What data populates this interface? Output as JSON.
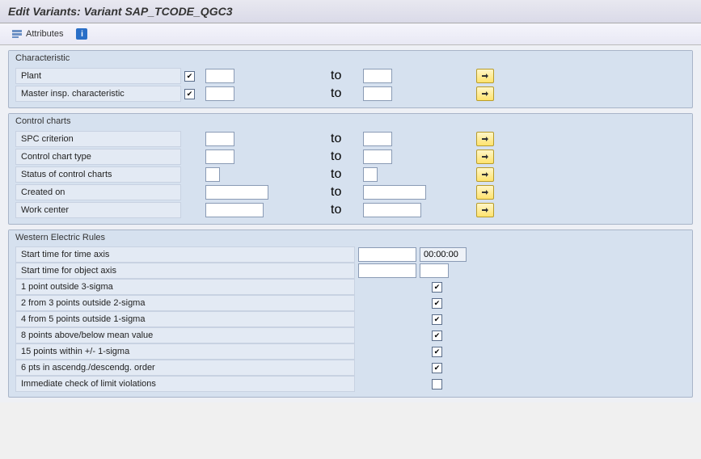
{
  "header": {
    "title": "Edit Variants: Variant SAP_TCODE_QGC3"
  },
  "toolbar": {
    "attributes_label": "Attributes"
  },
  "labels": {
    "to": "to"
  },
  "groups": {
    "characteristic": {
      "title": "Characteristic",
      "rows": {
        "plant": {
          "label": "Plant",
          "checked": true,
          "from": "",
          "to_val": ""
        },
        "mic": {
          "label": "Master insp. characteristic",
          "checked": true,
          "from": "",
          "to_val": ""
        }
      }
    },
    "control_charts": {
      "title": "Control charts",
      "rows": {
        "spc": {
          "label": "SPC criterion",
          "from": "",
          "to_val": ""
        },
        "cctype": {
          "label": "Control chart type",
          "from": "",
          "to_val": ""
        },
        "status": {
          "label": "Status of control charts",
          "from": "",
          "to_val": ""
        },
        "created": {
          "label": "Created on",
          "from": "",
          "to_val": ""
        },
        "workcenter": {
          "label": "Work center",
          "from": "",
          "to_val": ""
        }
      }
    },
    "wer": {
      "title": "Western Electric Rules",
      "rows": {
        "time_axis": {
          "label": "Start time for time axis",
          "val1": "",
          "val2": "00:00:00"
        },
        "object_axis": {
          "label": "Start time for object axis",
          "val1": "",
          "val2": ""
        },
        "r1": {
          "label": "1 point outside 3-sigma",
          "checked": true
        },
        "r2": {
          "label": "2 from 3 points outside 2-sigma",
          "checked": true
        },
        "r3": {
          "label": "4 from 5 points outside 1-sigma",
          "checked": true
        },
        "r4": {
          "label": "8 points above/below mean value",
          "checked": true
        },
        "r5": {
          "label": "15 points within +/- 1-sigma",
          "checked": true
        },
        "r6": {
          "label": "6 pts in ascendg./descendg. order",
          "checked": true
        },
        "r7": {
          "label": "Immediate check of limit violations",
          "checked": false
        }
      }
    }
  }
}
